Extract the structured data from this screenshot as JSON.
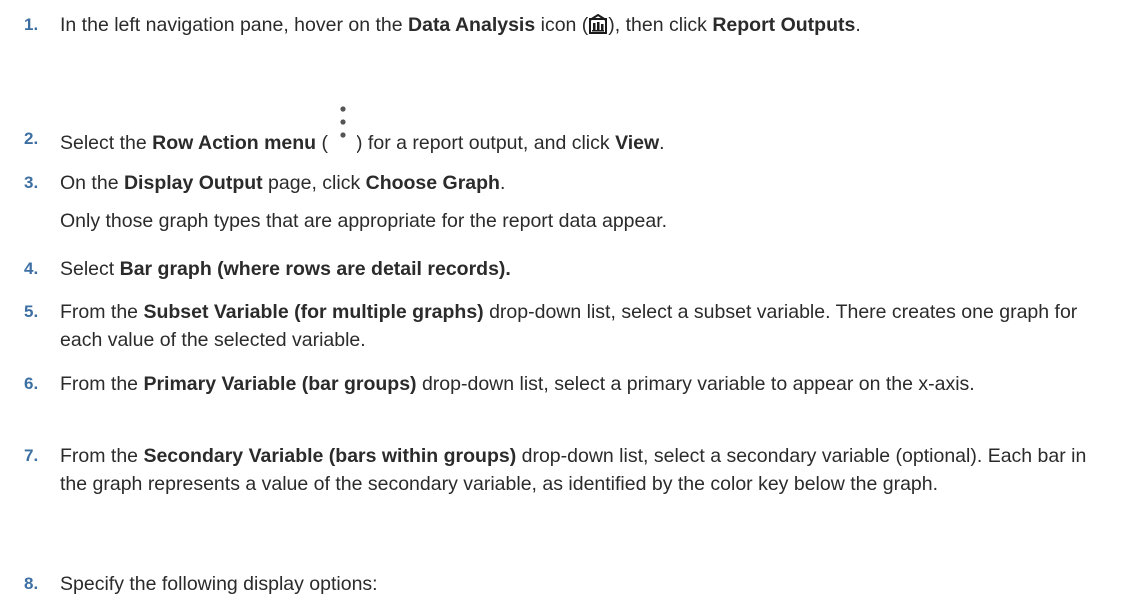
{
  "steps": [
    {
      "num": "1.",
      "t1": "In the left navigation pane, hover on the ",
      "b1": "Data Analysis",
      "t2": " icon (",
      "t3": "), then click ",
      "b2": "Report Outputs",
      "t4": "."
    },
    {
      "num": "2.",
      "t1": "Select the ",
      "b1": "Row Action menu",
      "t2": " (",
      "t3": ") for a report output, and click ",
      "b2": "View",
      "t4": "."
    },
    {
      "num": "3.",
      "t1": "On the ",
      "b1": "Display Output",
      "t2": " page, click ",
      "b2": "Choose Graph",
      "t3": ".",
      "sub": "Only those graph types that are appropriate for the report data appear."
    },
    {
      "num": "4.",
      "t1": "Select ",
      "b1": "Bar graph (where rows are detail records)."
    },
    {
      "num": "5.",
      "t1": "From the ",
      "b1": "Subset Variable (for multiple graphs)",
      "t2": " drop-down list, select a subset variable. There creates one graph for each value of the selected variable."
    },
    {
      "num": "6.",
      "t1": "From the ",
      "b1": "Primary Variable (bar groups)",
      "t2": " drop-down list, select a primary variable to appear on the x-axis."
    },
    {
      "num": "7.",
      "t1": "From the ",
      "b1": "Secondary Variable (bars within groups)",
      "t2": " drop-down list, select a secondary variable (optional). Each bar in the graph represents a value of the secondary variable, as identified by the color key below the graph."
    },
    {
      "num": "8.",
      "t1": "Specify the following display options:"
    }
  ],
  "icons": {
    "step1": "data-analysis-icon",
    "step2": "row-action-menu-icon"
  }
}
